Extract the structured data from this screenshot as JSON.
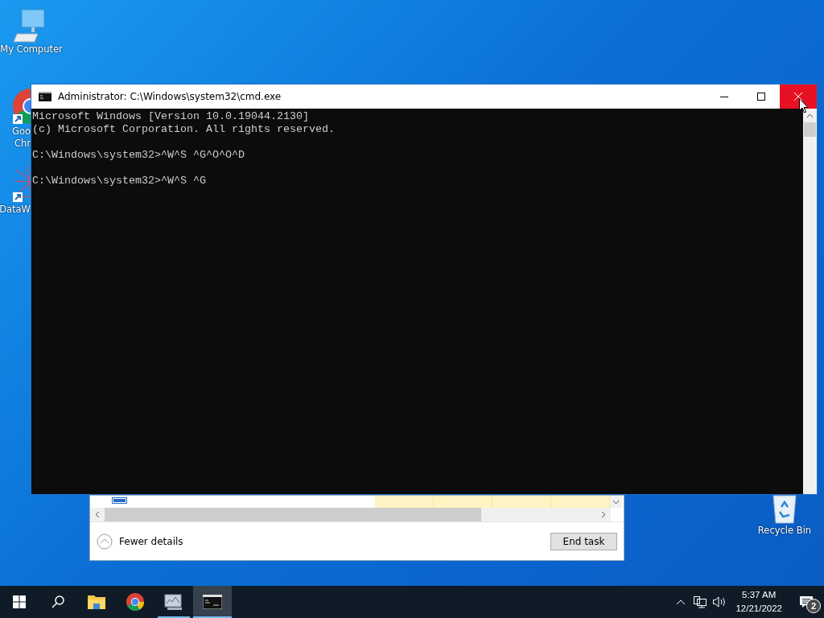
{
  "desktop_icons": [
    {
      "kind": "computer",
      "label_lines": [
        "My Computer"
      ]
    },
    {
      "kind": "chrome",
      "label_lines": [
        "Goo",
        "Chr"
      ]
    },
    {
      "kind": "network-app",
      "label_lines": [
        "DataW"
      ]
    },
    {
      "kind": "recycle-bin",
      "label_lines": [
        "Recycle Bin"
      ]
    }
  ],
  "task_manager": {
    "toggle": "Fewer details",
    "button": "End task"
  },
  "cmd_window": {
    "title": "Administrator: C:\\Windows\\system32\\cmd.exe",
    "close_hovered": true,
    "blocks": [
      [
        "Microsoft Windows [Version 10.0.19044.2130]",
        "(c) Microsoft Corporation. All rights reserved."
      ],
      [
        "C:\\Windows\\system32>^W^S ^G^O^O^D"
      ],
      [
        "C:\\Windows\\system32>^W^S ^G"
      ]
    ]
  },
  "taskbar": {
    "items": [
      {
        "kind": "start",
        "running": false,
        "selected": false
      },
      {
        "kind": "search",
        "running": false,
        "selected": false
      },
      {
        "kind": "explorer",
        "running": false,
        "selected": false
      },
      {
        "kind": "chrome",
        "running": false,
        "selected": false
      },
      {
        "kind": "taskmgr",
        "running": true,
        "selected": false
      },
      {
        "kind": "cmd",
        "running": true,
        "selected": true
      }
    ],
    "time": "5:37 AM",
    "date": "12/21/2022",
    "notification_count": "2"
  }
}
